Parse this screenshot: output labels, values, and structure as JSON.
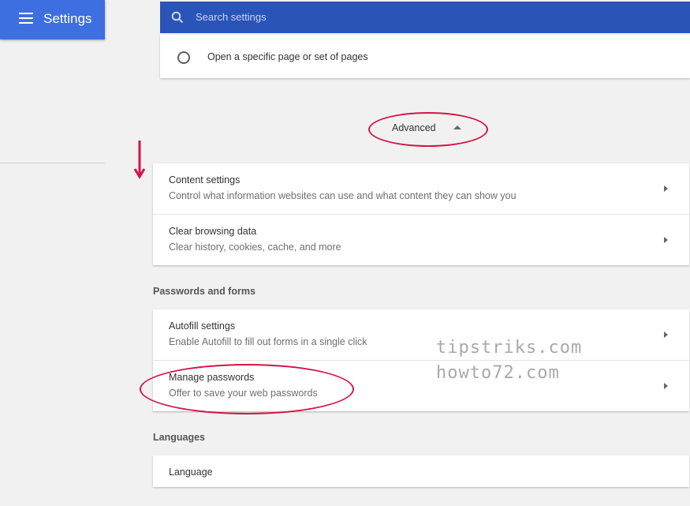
{
  "header": {
    "title": "Settings",
    "search_placeholder": "Search settings"
  },
  "on_startup": {
    "option_label": "Open a specific page or set of pages"
  },
  "advanced": {
    "label": "Advanced"
  },
  "privacy_rows": [
    {
      "title": "Content settings",
      "subtitle": "Control what information websites can use and what content they can show you"
    },
    {
      "title": "Clear browsing data",
      "subtitle": "Clear history, cookies, cache, and more"
    }
  ],
  "passwords_section": {
    "title": "Passwords and forms",
    "rows": [
      {
        "title": "Autofill settings",
        "subtitle": "Enable Autofill to fill out forms in a single click"
      },
      {
        "title": "Manage passwords",
        "subtitle": "Offer to save your web passwords"
      }
    ]
  },
  "languages_section": {
    "title": "Languages",
    "rows": [
      {
        "title": "Language"
      }
    ]
  },
  "watermark": {
    "line1": "tipstriks.com",
    "line2": "howto72.com"
  },
  "colors": {
    "header_blue": "#3d6fe0",
    "search_blue": "#2a54b7",
    "annotation_red": "#d4144a"
  }
}
